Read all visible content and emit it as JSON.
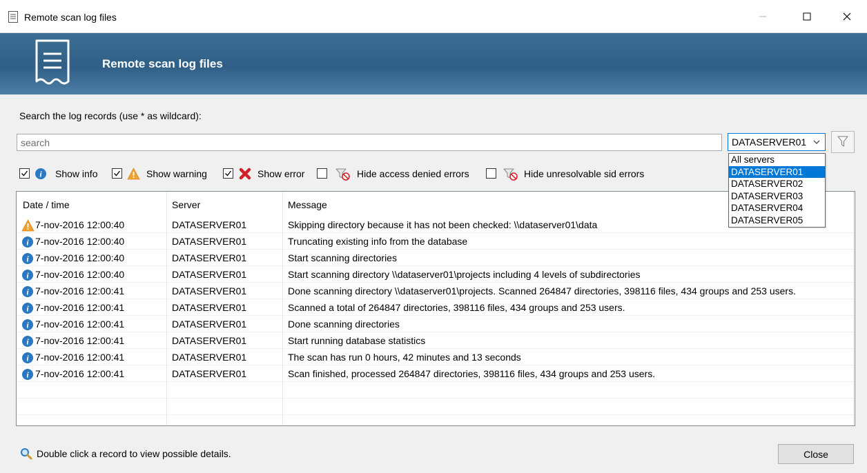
{
  "window": {
    "title": "Remote scan log files"
  },
  "banner": {
    "title": "Remote scan log files"
  },
  "search": {
    "label": "Search the log records (use * as wildcard):",
    "placeholder": "search",
    "value": ""
  },
  "server_select": {
    "selected": "DATASERVER01",
    "options": [
      "All servers",
      "DATASERVER01",
      "DATASERVER02",
      "DATASERVER03",
      "DATASERVER04",
      "DATASERVER05"
    ],
    "highlighted": "DATASERVER01"
  },
  "filters": {
    "show_info": {
      "label": "Show info",
      "checked": true
    },
    "show_warning": {
      "label": "Show warning",
      "checked": true
    },
    "show_error": {
      "label": "Show error",
      "checked": true
    },
    "hide_access_denied": {
      "label": "Hide access denied errors",
      "checked": false
    },
    "hide_unresolvable_sid": {
      "label": "Hide unresolvable sid errors",
      "checked": false
    }
  },
  "table": {
    "columns": [
      "Date / time",
      "Server",
      "Message"
    ],
    "rows": [
      {
        "type": "warning",
        "datetime": "7-nov-2016 12:00:40",
        "server": "DATASERVER01",
        "message": "Skipping directory because it has not been checked: \\\\dataserver01\\data"
      },
      {
        "type": "info",
        "datetime": "7-nov-2016 12:00:40",
        "server": "DATASERVER01",
        "message": "Truncating existing info from the database"
      },
      {
        "type": "info",
        "datetime": "7-nov-2016 12:00:40",
        "server": "DATASERVER01",
        "message": "Start scanning directories"
      },
      {
        "type": "info",
        "datetime": "7-nov-2016 12:00:40",
        "server": "DATASERVER01",
        "message": "Start scanning directory \\\\dataserver01\\projects including 4 levels of subdirectories"
      },
      {
        "type": "info",
        "datetime": "7-nov-2016 12:00:41",
        "server": "DATASERVER01",
        "message": "Done scanning directory \\\\dataserver01\\projects. Scanned 264847 directories, 398116 files, 434 groups and 253 users."
      },
      {
        "type": "info",
        "datetime": "7-nov-2016 12:00:41",
        "server": "DATASERVER01",
        "message": "Scanned a total of 264847 directories, 398116 files, 434 groups and 253 users."
      },
      {
        "type": "info",
        "datetime": "7-nov-2016 12:00:41",
        "server": "DATASERVER01",
        "message": "Done scanning directories"
      },
      {
        "type": "info",
        "datetime": "7-nov-2016 12:00:41",
        "server": "DATASERVER01",
        "message": "Start running database statistics"
      },
      {
        "type": "info",
        "datetime": "7-nov-2016 12:00:41",
        "server": "DATASERVER01",
        "message": "The scan has run 0 hours, 42 minutes and 13 seconds"
      },
      {
        "type": "info",
        "datetime": "7-nov-2016 12:00:41",
        "server": "DATASERVER01",
        "message": "Scan finished, processed 264847 directories, 398116 files, 434 groups and 253 users."
      }
    ]
  },
  "footer": {
    "hint": "Double click a record to view possible details.",
    "close_label": "Close"
  },
  "colors": {
    "banner": "#2f5f86",
    "selection": "#0078d7",
    "info": "#2b79c2",
    "warning": "#f0a030",
    "error": "#d0202a"
  }
}
